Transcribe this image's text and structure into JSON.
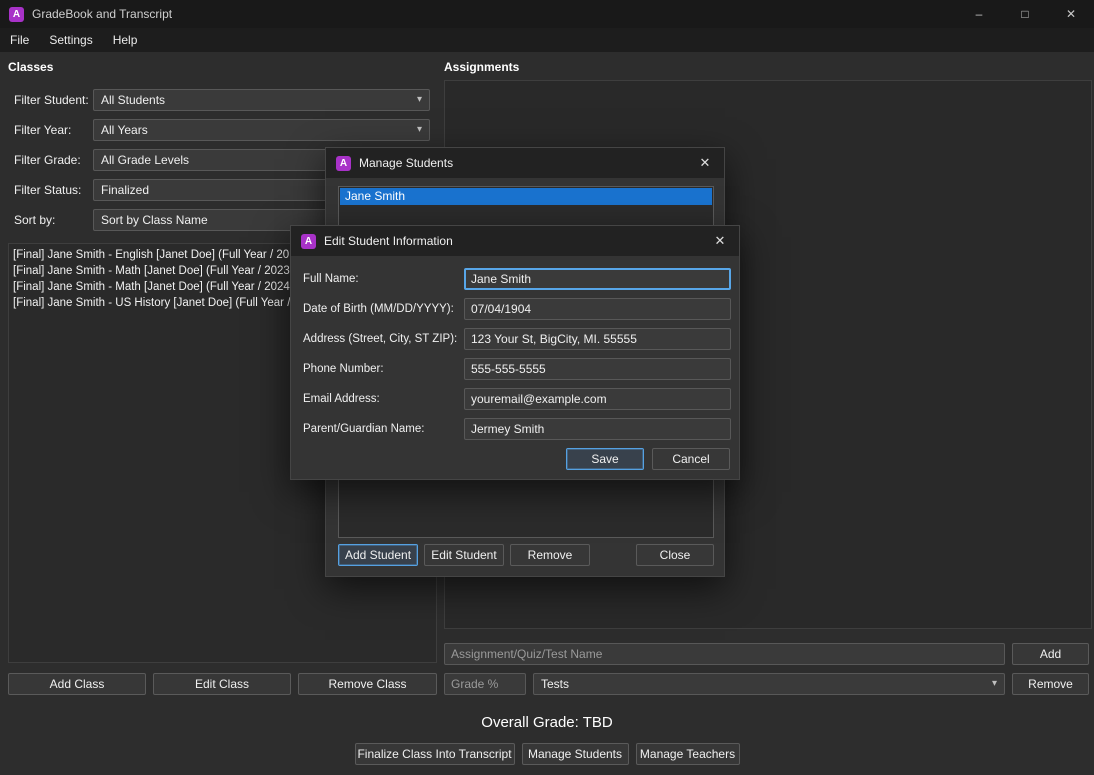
{
  "icons": {
    "app_glyph": "A",
    "chevron": "▾",
    "close": "✕",
    "minimize": "–",
    "maximize": "□"
  },
  "colors": {
    "accent_blue": "#55a1e2",
    "selection_blue": "#1a73cf",
    "brand_purple": "#a832c8"
  },
  "window": {
    "title": "GradeBook and Transcript"
  },
  "menu": {
    "items": [
      {
        "label": "File"
      },
      {
        "label": "Settings"
      },
      {
        "label": "Help"
      }
    ]
  },
  "classes_panel": {
    "title": "Classes",
    "filters": [
      {
        "label": "Filter Student:",
        "value": "All Students"
      },
      {
        "label": "Filter Year:",
        "value": "All Years"
      },
      {
        "label": "Filter Grade:",
        "value": "All Grade Levels"
      },
      {
        "label": "Filter Status:",
        "value": "Finalized"
      },
      {
        "label": "Sort by:",
        "value": "Sort by Class Name"
      }
    ],
    "class_list": [
      "[Final] Jane Smith - English [Janet Doe] (Full Year / 20",
      "[Final] Jane Smith - Math [Janet Doe] (Full Year / 2023",
      "[Final] Jane Smith - Math [Janet Doe] (Full Year / 2024",
      "[Final] Jane Smith - US History [Janet Doe] (Full Year /"
    ],
    "buttons": {
      "add": "Add Class",
      "edit": "Edit Class",
      "remove": "Remove Class"
    }
  },
  "assignments_panel": {
    "title": "Assignments",
    "name_placeholder": "Assignment/Quiz/Test Name",
    "add_button": "Add",
    "grade_placeholder": "Grade %",
    "type_value": "Tests",
    "remove_button": "Remove"
  },
  "footer": {
    "overall_grade": "Overall Grade: TBD",
    "buttons": {
      "finalize": "Finalize Class Into Transcript",
      "manage_students": "Manage Students",
      "manage_teachers": "Manage Teachers"
    }
  },
  "manage_students_dialog": {
    "title": "Manage Students",
    "students": [
      {
        "name": "Jane Smith"
      }
    ],
    "buttons": {
      "add": "Add Student",
      "edit": "Edit Student",
      "remove": "Remove",
      "close": "Close"
    }
  },
  "edit_student_dialog": {
    "title": "Edit Student Information",
    "fields": [
      {
        "label": "Full Name:",
        "value": "Jane Smith"
      },
      {
        "label": "Date of Birth (MM/DD/YYYY):",
        "value": "07/04/1904"
      },
      {
        "label": "Address (Street, City, ST ZIP):",
        "value": "123 Your St, BigCity, MI. 55555"
      },
      {
        "label": "Phone Number:",
        "value": "555-555-5555"
      },
      {
        "label": "Email Address:",
        "value": "youremail@example.com"
      },
      {
        "label": "Parent/Guardian Name:",
        "value": "Jermey Smith"
      }
    ],
    "buttons": {
      "save": "Save",
      "cancel": "Cancel"
    }
  }
}
